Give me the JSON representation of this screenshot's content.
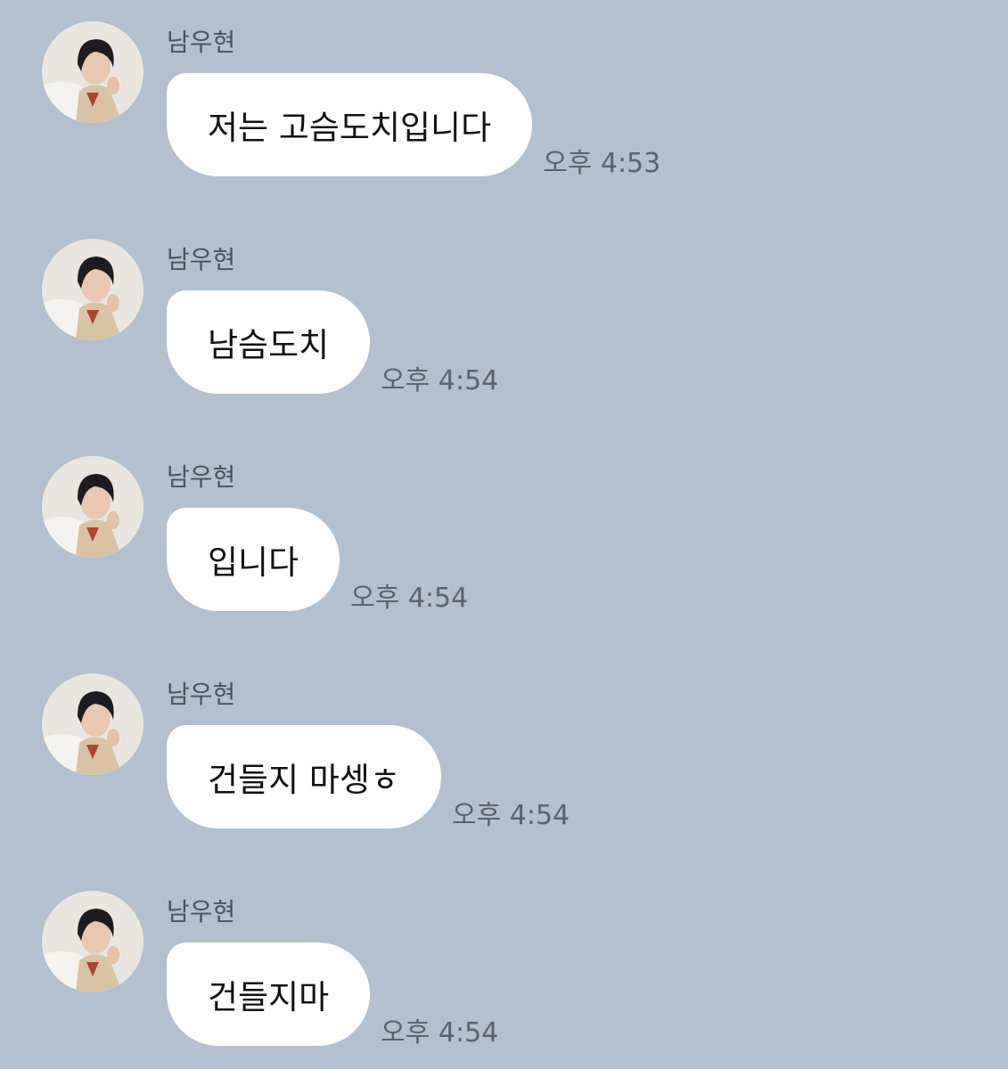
{
  "messages": [
    {
      "sender": "남우현",
      "text": "저는 고슴도치입니다",
      "time": "오후 4:53"
    },
    {
      "sender": "남우현",
      "text": "남슴도치",
      "time": "오후 4:54"
    },
    {
      "sender": "남우현",
      "text": "입니다",
      "time": "오후 4:54"
    },
    {
      "sender": "남우현",
      "text": "건들지 마셍ㅎ",
      "time": "오후 4:54"
    },
    {
      "sender": "남우현",
      "text": "건들지마",
      "time": "오후 4:54"
    }
  ],
  "colors": {
    "background": "#b2c0cf",
    "bubble": "#ffffff",
    "sender_text": "#4a525c",
    "time_text": "#5a626c"
  },
  "icons": {
    "avatar": "profile-photo"
  }
}
